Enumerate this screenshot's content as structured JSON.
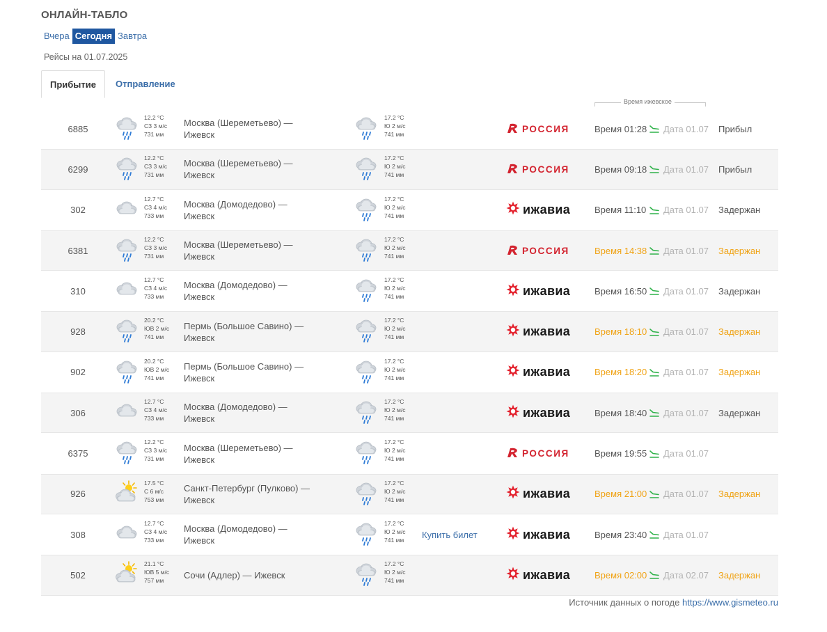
{
  "page": {
    "title": "ОНЛАЙН-ТАБЛО",
    "flights_date_label": "Рейсы на 01.07.2025"
  },
  "day_switch": {
    "yesterday": "Вчера",
    "today": "Сегодня",
    "tomorrow": "Завтра",
    "selected": "Сегодня"
  },
  "tabs": {
    "arrival": "Прибытие",
    "departure": "Отправление",
    "active": "Прибытие"
  },
  "timezone_caption": "Время ижевское",
  "colors": {
    "link": "#3b6ea9",
    "active_day_bg": "#1f57a0",
    "delayed": "#f0a315",
    "rossiya": "#d3232f",
    "plane_icon": "#2fb24a"
  },
  "flights": [
    {
      "number": "6885",
      "origin_weather": {
        "icon": "cloud-rain-icon",
        "temp": "12.2 °C",
        "wind": "СЗ 3 м/с",
        "pressure": "731 мм"
      },
      "route": "Москва (Шереметьево) — Ижевск",
      "dest_weather": {
        "icon": "cloud-rain-icon",
        "temp": "17.2 °C",
        "wind": "Ю 2 м/с",
        "pressure": "741 мм"
      },
      "buy_label": "",
      "airline": "РОССИЯ",
      "airline_logo": "rossiya",
      "time": "Время 01:28",
      "time_delayed": false,
      "date": "Дата 01.07",
      "status": "Прибыл",
      "status_delayed": false
    },
    {
      "number": "6299",
      "origin_weather": {
        "icon": "cloud-rain-icon",
        "temp": "12.2 °C",
        "wind": "СЗ 3 м/с",
        "pressure": "731 мм"
      },
      "route": "Москва (Шереметьево) — Ижевск",
      "dest_weather": {
        "icon": "cloud-rain-icon",
        "temp": "17.2 °C",
        "wind": "Ю 2 м/с",
        "pressure": "741 мм"
      },
      "buy_label": "",
      "airline": "РОССИЯ",
      "airline_logo": "rossiya",
      "time": "Время 09:18",
      "time_delayed": false,
      "date": "Дата 01.07",
      "status": "Прибыл",
      "status_delayed": false
    },
    {
      "number": "302",
      "origin_weather": {
        "icon": "cloud-icon",
        "temp": "12.7 °C",
        "wind": "СЗ 4 м/с",
        "pressure": "733 мм"
      },
      "route": "Москва (Домодедово) — Ижевск",
      "dest_weather": {
        "icon": "cloud-rain-icon",
        "temp": "17.2 °C",
        "wind": "Ю 2 м/с",
        "pressure": "741 мм"
      },
      "buy_label": "",
      "airline": "ижавиа",
      "airline_logo": "izhavia",
      "time": "Время 11:10",
      "time_delayed": false,
      "date": "Дата 01.07",
      "status": "Задержан",
      "status_delayed": false
    },
    {
      "number": "6381",
      "origin_weather": {
        "icon": "cloud-rain-icon",
        "temp": "12.2 °C",
        "wind": "СЗ 3 м/с",
        "pressure": "731 мм"
      },
      "route": "Москва (Шереметьево) — Ижевск",
      "dest_weather": {
        "icon": "cloud-rain-icon",
        "temp": "17.2 °C",
        "wind": "Ю 2 м/с",
        "pressure": "741 мм"
      },
      "buy_label": "",
      "airline": "РОССИЯ",
      "airline_logo": "rossiya",
      "time": "Время 14:38",
      "time_delayed": true,
      "date": "Дата 01.07",
      "status": "Задержан",
      "status_delayed": true
    },
    {
      "number": "310",
      "origin_weather": {
        "icon": "cloud-icon",
        "temp": "12.7 °C",
        "wind": "СЗ 4 м/с",
        "pressure": "733 мм"
      },
      "route": "Москва (Домодедово) — Ижевск",
      "dest_weather": {
        "icon": "cloud-rain-icon",
        "temp": "17.2 °C",
        "wind": "Ю 2 м/с",
        "pressure": "741 мм"
      },
      "buy_label": "",
      "airline": "ижавиа",
      "airline_logo": "izhavia",
      "time": "Время 16:50",
      "time_delayed": false,
      "date": "Дата 01.07",
      "status": "Задержан",
      "status_delayed": false
    },
    {
      "number": "928",
      "origin_weather": {
        "icon": "cloud-rain-icon",
        "temp": "20.2 °C",
        "wind": "ЮВ 2 м/с",
        "pressure": "741 мм"
      },
      "route": "Пермь (Большое Савино) — Ижевск",
      "dest_weather": {
        "icon": "cloud-rain-icon",
        "temp": "17.2 °C",
        "wind": "Ю 2 м/с",
        "pressure": "741 мм"
      },
      "buy_label": "",
      "airline": "ижавиа",
      "airline_logo": "izhavia",
      "time": "Время 18:10",
      "time_delayed": true,
      "date": "Дата 01.07",
      "status": "Задержан",
      "status_delayed": true
    },
    {
      "number": "902",
      "origin_weather": {
        "icon": "cloud-rain-icon",
        "temp": "20.2 °C",
        "wind": "ЮВ 2 м/с",
        "pressure": "741 мм"
      },
      "route": "Пермь (Большое Савино) — Ижевск",
      "dest_weather": {
        "icon": "cloud-rain-icon",
        "temp": "17.2 °C",
        "wind": "Ю 2 м/с",
        "pressure": "741 мм"
      },
      "buy_label": "",
      "airline": "ижавиа",
      "airline_logo": "izhavia",
      "time": "Время 18:20",
      "time_delayed": true,
      "date": "Дата 01.07",
      "status": "Задержан",
      "status_delayed": true
    },
    {
      "number": "306",
      "origin_weather": {
        "icon": "cloud-icon",
        "temp": "12.7 °C",
        "wind": "СЗ 4 м/с",
        "pressure": "733 мм"
      },
      "route": "Москва (Домодедово) — Ижевск",
      "dest_weather": {
        "icon": "cloud-rain-icon",
        "temp": "17.2 °C",
        "wind": "Ю 2 м/с",
        "pressure": "741 мм"
      },
      "buy_label": "",
      "airline": "ижавиа",
      "airline_logo": "izhavia",
      "time": "Время 18:40",
      "time_delayed": false,
      "date": "Дата 01.07",
      "status": "Задержан",
      "status_delayed": false
    },
    {
      "number": "6375",
      "origin_weather": {
        "icon": "cloud-rain-icon",
        "temp": "12.2 °C",
        "wind": "СЗ 3 м/с",
        "pressure": "731 мм"
      },
      "route": "Москва (Шереметьево) — Ижевск",
      "dest_weather": {
        "icon": "cloud-rain-icon",
        "temp": "17.2 °C",
        "wind": "Ю 2 м/с",
        "pressure": "741 мм"
      },
      "buy_label": "",
      "airline": "РОССИЯ",
      "airline_logo": "rossiya",
      "time": "Время 19:55",
      "time_delayed": false,
      "date": "Дата 01.07",
      "status": "",
      "status_delayed": false
    },
    {
      "number": "926",
      "origin_weather": {
        "icon": "sun-cloud-icon",
        "temp": "17.5 °C",
        "wind": "С 6 м/с",
        "pressure": "753 мм"
      },
      "route": "Санкт-Петербург (Пулково) — Ижевск",
      "dest_weather": {
        "icon": "cloud-rain-icon",
        "temp": "17.2 °C",
        "wind": "Ю 2 м/с",
        "pressure": "741 мм"
      },
      "buy_label": "",
      "airline": "ижавиа",
      "airline_logo": "izhavia",
      "time": "Время 21:00",
      "time_delayed": true,
      "date": "Дата 01.07",
      "status": "Задержан",
      "status_delayed": true
    },
    {
      "number": "308",
      "origin_weather": {
        "icon": "cloud-icon",
        "temp": "12.7 °C",
        "wind": "СЗ 4 м/с",
        "pressure": "733 мм"
      },
      "route": "Москва (Домодедово) — Ижевск",
      "dest_weather": {
        "icon": "cloud-rain-icon",
        "temp": "17.2 °C",
        "wind": "Ю 2 м/с",
        "pressure": "741 мм"
      },
      "buy_label": "Купить билет",
      "airline": "ижавиа",
      "airline_logo": "izhavia",
      "time": "Время 23:40",
      "time_delayed": false,
      "date": "Дата 01.07",
      "status": "",
      "status_delayed": false
    },
    {
      "number": "502",
      "origin_weather": {
        "icon": "sun-cloud-icon",
        "temp": "21.1 °C",
        "wind": "ЮВ 5 м/с",
        "pressure": "757 мм"
      },
      "route": "Сочи (Адлер) — Ижевск",
      "dest_weather": {
        "icon": "cloud-rain-icon",
        "temp": "17.2 °C",
        "wind": "Ю 2 м/с",
        "pressure": "741 мм"
      },
      "buy_label": "",
      "airline": "ижавиа",
      "airline_logo": "izhavia",
      "time": "Время 02:00",
      "time_delayed": true,
      "date": "Дата 02.07",
      "status": "Задержан",
      "status_delayed": true
    }
  ],
  "footer": {
    "source_label": "Источник данных о погоде",
    "source_link": "https://www.gismeteo.ru"
  }
}
